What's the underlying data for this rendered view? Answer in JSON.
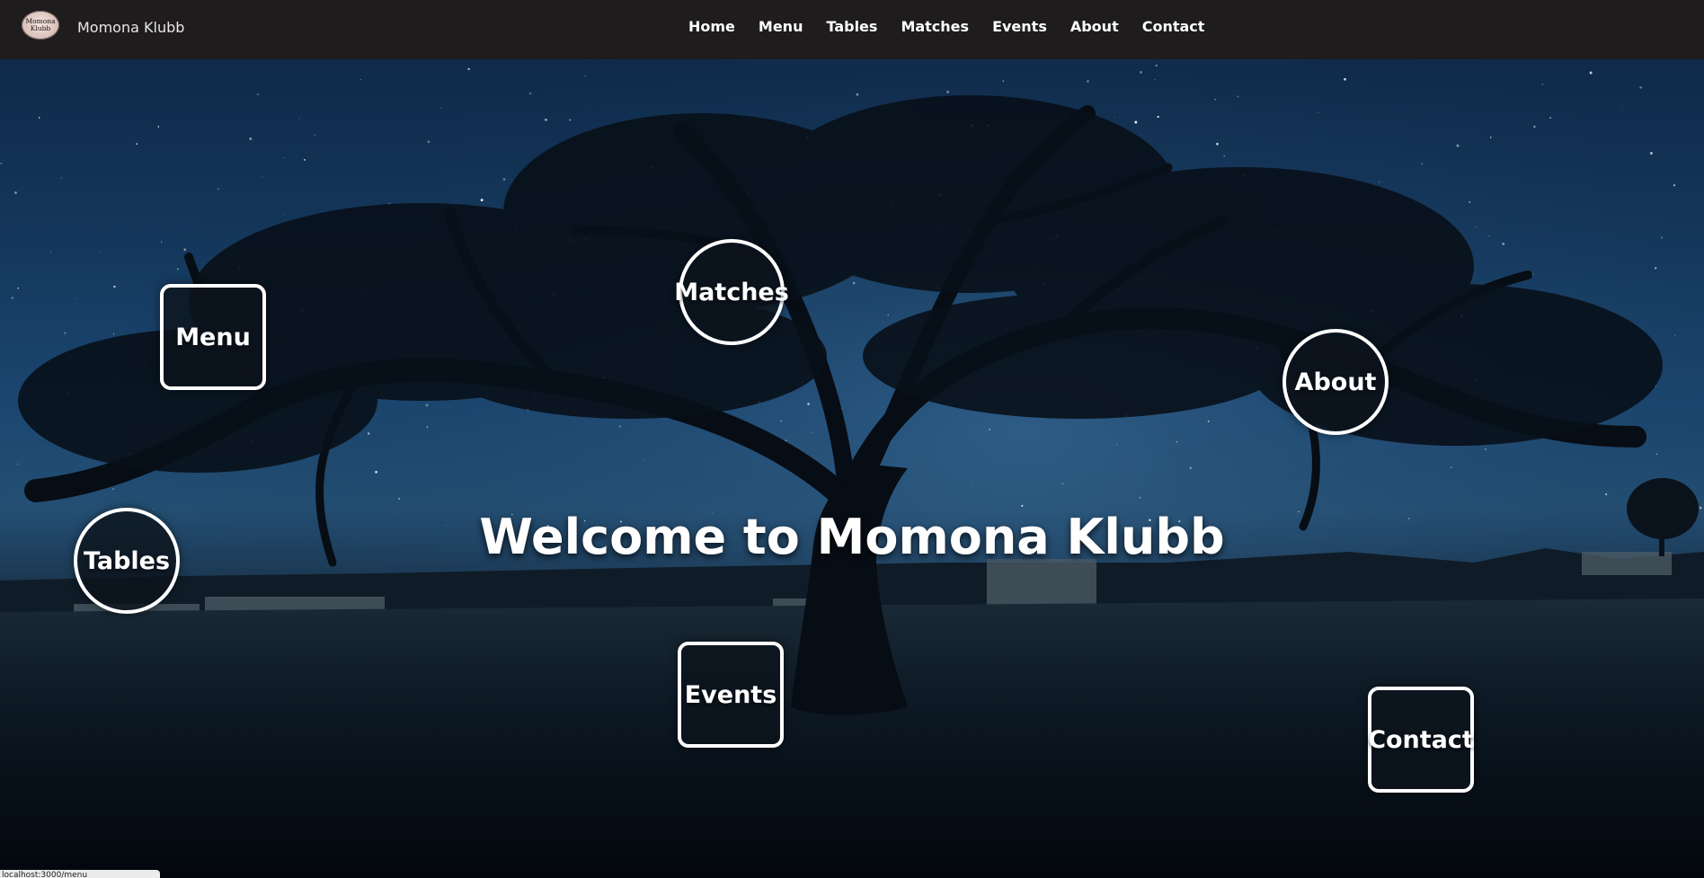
{
  "brand": {
    "logo_text_line1": "Momona",
    "logo_text_line2": "Klubb",
    "name": "Momona Klubb"
  },
  "nav": {
    "items": [
      {
        "label": "Home"
      },
      {
        "label": "Menu"
      },
      {
        "label": "Tables"
      },
      {
        "label": "Matches"
      },
      {
        "label": "Events"
      },
      {
        "label": "About"
      },
      {
        "label": "Contact"
      }
    ]
  },
  "hero": {
    "title": "Welcome to Momona Klubb",
    "nodes": {
      "menu": "Menu",
      "matches": "Matches",
      "about": "About",
      "tables": "Tables",
      "events": "Events",
      "contact": "Contact"
    }
  },
  "status_bar": {
    "url": "localhost:3000/menu"
  },
  "colors": {
    "navbar_bg": "#1e1c1c",
    "node_border": "#ffffff",
    "sky_top": "#0f2a4a",
    "ground": "#060b12"
  },
  "icons": {
    "logo": "momona-klubb-logo"
  }
}
